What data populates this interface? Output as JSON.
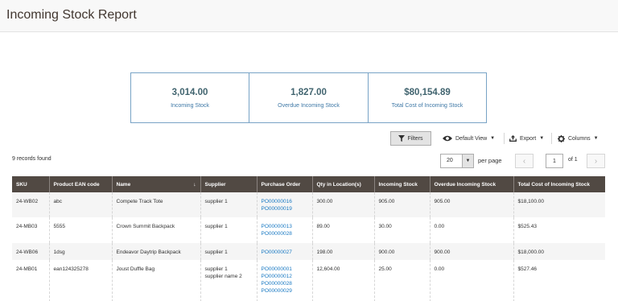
{
  "page": {
    "title": "Incoming Stock Report"
  },
  "stats": [
    {
      "value": "3,014.00",
      "label": "Incoming Stock"
    },
    {
      "value": "1,827.00",
      "label": "Overdue Incoming Stock"
    },
    {
      "value": "$80,154.89",
      "label": "Total Cost of Incoming Stock"
    }
  ],
  "toolbar": {
    "filters_label": "Filters",
    "view_label": "Default View",
    "export_label": "Export",
    "columns_label": "Columns"
  },
  "grid": {
    "records_found": "9 records found",
    "per_page_value": "20",
    "per_page_label": "per page",
    "page_value": "1",
    "page_of": "of 1",
    "columns": [
      "SKU",
      "Product EAN code",
      "Name",
      "Supplier",
      "Purchase Order",
      "Qty in Location(s)",
      "Incoming Stock",
      "Overdue Incoming Stock",
      "Total Cost of Incoming Stock"
    ],
    "rows": [
      {
        "sku": "24-WB02",
        "ean": "abc",
        "name": "Compete Track Tote",
        "supplier": [
          "supplier 1"
        ],
        "po": [
          "PO00000016",
          "PO00000019"
        ],
        "qty": "300.00",
        "incoming": "905.00",
        "overdue": "905.00",
        "cost": "$18,100.00"
      },
      {
        "sku": "24-MB03",
        "ean": "5555",
        "name": "Crown Summit Backpack",
        "supplier": [
          "supplier 1"
        ],
        "po": [
          "PO00000013",
          "PO00000028"
        ],
        "qty": "89.00",
        "incoming": "30.00",
        "overdue": "0.00",
        "cost": "$525.43"
      },
      {
        "sku": "24-WB06",
        "ean": "1dsg",
        "name": "Endeavor Daytrip Backpack",
        "supplier": [
          "supplier 1"
        ],
        "po": [
          "PO00000027"
        ],
        "qty": "198.00",
        "incoming": "900.00",
        "overdue": "900.00",
        "cost": "$18,000.00"
      },
      {
        "sku": "24-MB01",
        "ean": "ean124325278",
        "name": "Joust Duffle Bag",
        "supplier": [
          "supplier 1",
          "supplier name 2"
        ],
        "po": [
          "PO00000001",
          "PO00000012",
          "PO00000028",
          "PO00000029"
        ],
        "qty": "12,604.00",
        "incoming": "25.00",
        "overdue": "0.00",
        "cost": "$527.46"
      }
    ]
  }
}
